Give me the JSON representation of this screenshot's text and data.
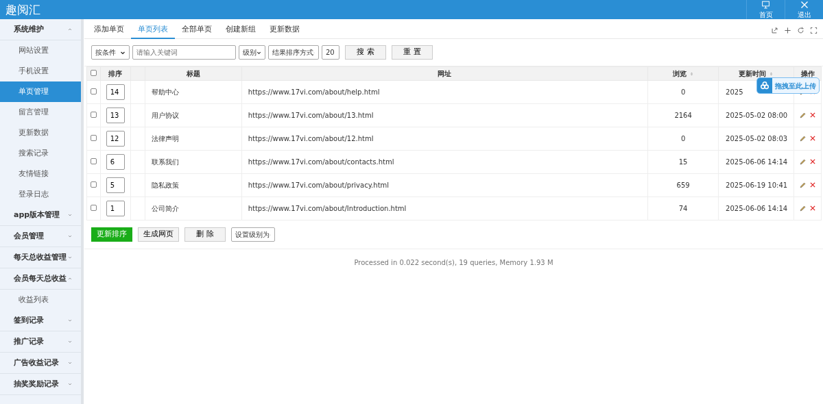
{
  "app": {
    "title": "趣阅汇"
  },
  "header_buttons": [
    {
      "kind": "monitor",
      "label": "首页"
    },
    {
      "kind": "close",
      "label": "退出"
    }
  ],
  "sidebar": {
    "items": [
      {
        "label": "系统维护",
        "expanded": true,
        "children": [
          {
            "label": "网站设置",
            "selected": false
          },
          {
            "label": "手机设置",
            "selected": false
          },
          {
            "label": "单页管理",
            "selected": true
          },
          {
            "label": "留言管理",
            "selected": false
          },
          {
            "label": "更新数据",
            "selected": false
          },
          {
            "label": "搜索记录",
            "selected": false
          },
          {
            "label": "友情链接",
            "selected": false
          },
          {
            "label": "登录日志",
            "selected": false
          }
        ]
      },
      {
        "label": "app版本管理",
        "expanded": false
      },
      {
        "label": "会员管理",
        "expanded": false
      },
      {
        "label": "每天总收益管理",
        "expanded": false
      },
      {
        "label": "会员每天总收益",
        "expanded": true,
        "children": [
          {
            "label": "收益列表",
            "selected": false
          }
        ]
      },
      {
        "label": "签到记录",
        "expanded": false
      },
      {
        "label": "推广记录",
        "expanded": false
      },
      {
        "label": "广告收益记录",
        "expanded": false
      },
      {
        "label": "抽奖奖励记录",
        "expanded": false
      }
    ]
  },
  "tabs": [
    {
      "label": "添加单页",
      "selected": false
    },
    {
      "label": "单页列表",
      "selected": true
    },
    {
      "label": "全部单页",
      "selected": false
    },
    {
      "label": "创建新组",
      "selected": false
    },
    {
      "label": "更新数据",
      "selected": false
    }
  ],
  "filters": {
    "condition": "按条件",
    "keyword_placeholder": "请输入关键词",
    "level": "级别",
    "sort": "结果排序方式",
    "count": "20",
    "search_button": "搜 索",
    "reset_button": "重 置"
  },
  "table": {
    "columns": [
      {
        "kind": "checkbox",
        "checked": false
      },
      {
        "kind": "text",
        "label": "排序",
        "sortable": false
      },
      {
        "kind": "blank"
      },
      {
        "kind": "text",
        "label": "标题",
        "sortable": false
      },
      {
        "kind": "text",
        "label": "网址",
        "sortable": false
      },
      {
        "kind": "text",
        "label": "浏览",
        "sortable": true
      },
      {
        "kind": "text",
        "label": "更新时间",
        "sortable": true
      },
      {
        "kind": "text",
        "label": "操作",
        "sortable": false
      }
    ],
    "rows": [
      {
        "checked": false,
        "order": "14",
        "title": "帮助中心",
        "url": "https://www.17vi.com/about/help.html",
        "views": "0",
        "updated": "2025"
      },
      {
        "checked": false,
        "order": "13",
        "title": "用户协议",
        "url": "https://www.17vi.com/about/13.html",
        "views": "2164",
        "updated": "2025-05-02 08:00"
      },
      {
        "checked": false,
        "order": "12",
        "title": "法律声明",
        "url": "https://www.17vi.com/about/12.html",
        "views": "0",
        "updated": "2025-05-02 08:03"
      },
      {
        "checked": false,
        "order": "6",
        "title": "联系我们",
        "url": "https://www.17vi.com/about/contacts.html",
        "views": "15",
        "updated": "2025-06-06 14:14"
      },
      {
        "checked": false,
        "order": "5",
        "title": "隐私政策",
        "url": "https://www.17vi.com/about/privacy.html",
        "views": "659",
        "updated": "2025-06-19 10:41"
      },
      {
        "checked": false,
        "order": "1",
        "title": "公司简介",
        "url": "https://www.17vi.com/about/Introduction.html",
        "views": "74",
        "updated": "2025-06-06 14:14"
      }
    ]
  },
  "actions": [
    {
      "kind": "primary",
      "label": "更新排序"
    },
    {
      "kind": "default",
      "label": "生成网页"
    },
    {
      "kind": "default",
      "label": "删 除"
    },
    {
      "kind": "select",
      "label": "设置级别为"
    }
  ],
  "footer": "Processed in 0.022 second(s), 19 queries, Memory 1.93 M",
  "upload_widget": {
    "label": "拖拽至此上传"
  }
}
